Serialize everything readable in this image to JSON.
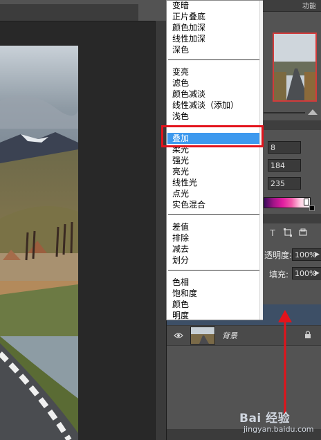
{
  "panel_header_text": "功能",
  "color_values": {
    "r": "8",
    "g": "184",
    "b": "235"
  },
  "layer_options": {
    "opacity_label": "透明度:",
    "opacity_value": "100%",
    "fill_label": "填充:",
    "fill_value": "100%"
  },
  "layer": {
    "name": "背景"
  },
  "blend_menu": {
    "groups": [
      [
        "变暗",
        "正片叠底",
        "颜色加深",
        "线性加深",
        "深色"
      ],
      [
        "变亮",
        "滤色",
        "颜色减淡",
        "线性减淡（添加）",
        "浅色"
      ],
      [
        "叠加",
        "柔光",
        "强光",
        "亮光",
        "线性光",
        "点光",
        "实色混合"
      ],
      [
        "差值",
        "排除",
        "减去",
        "划分"
      ],
      [
        "色相",
        "饱和度",
        "颜色",
        "明度"
      ]
    ],
    "selected": "叠加"
  },
  "watermark": {
    "brand": "Bai 经验",
    "site": "jingyan.baidu.com"
  },
  "colors": {
    "selection_blue": "#3d99ee",
    "highlight_red": "#e3131b",
    "panel_bg": "#535353"
  }
}
